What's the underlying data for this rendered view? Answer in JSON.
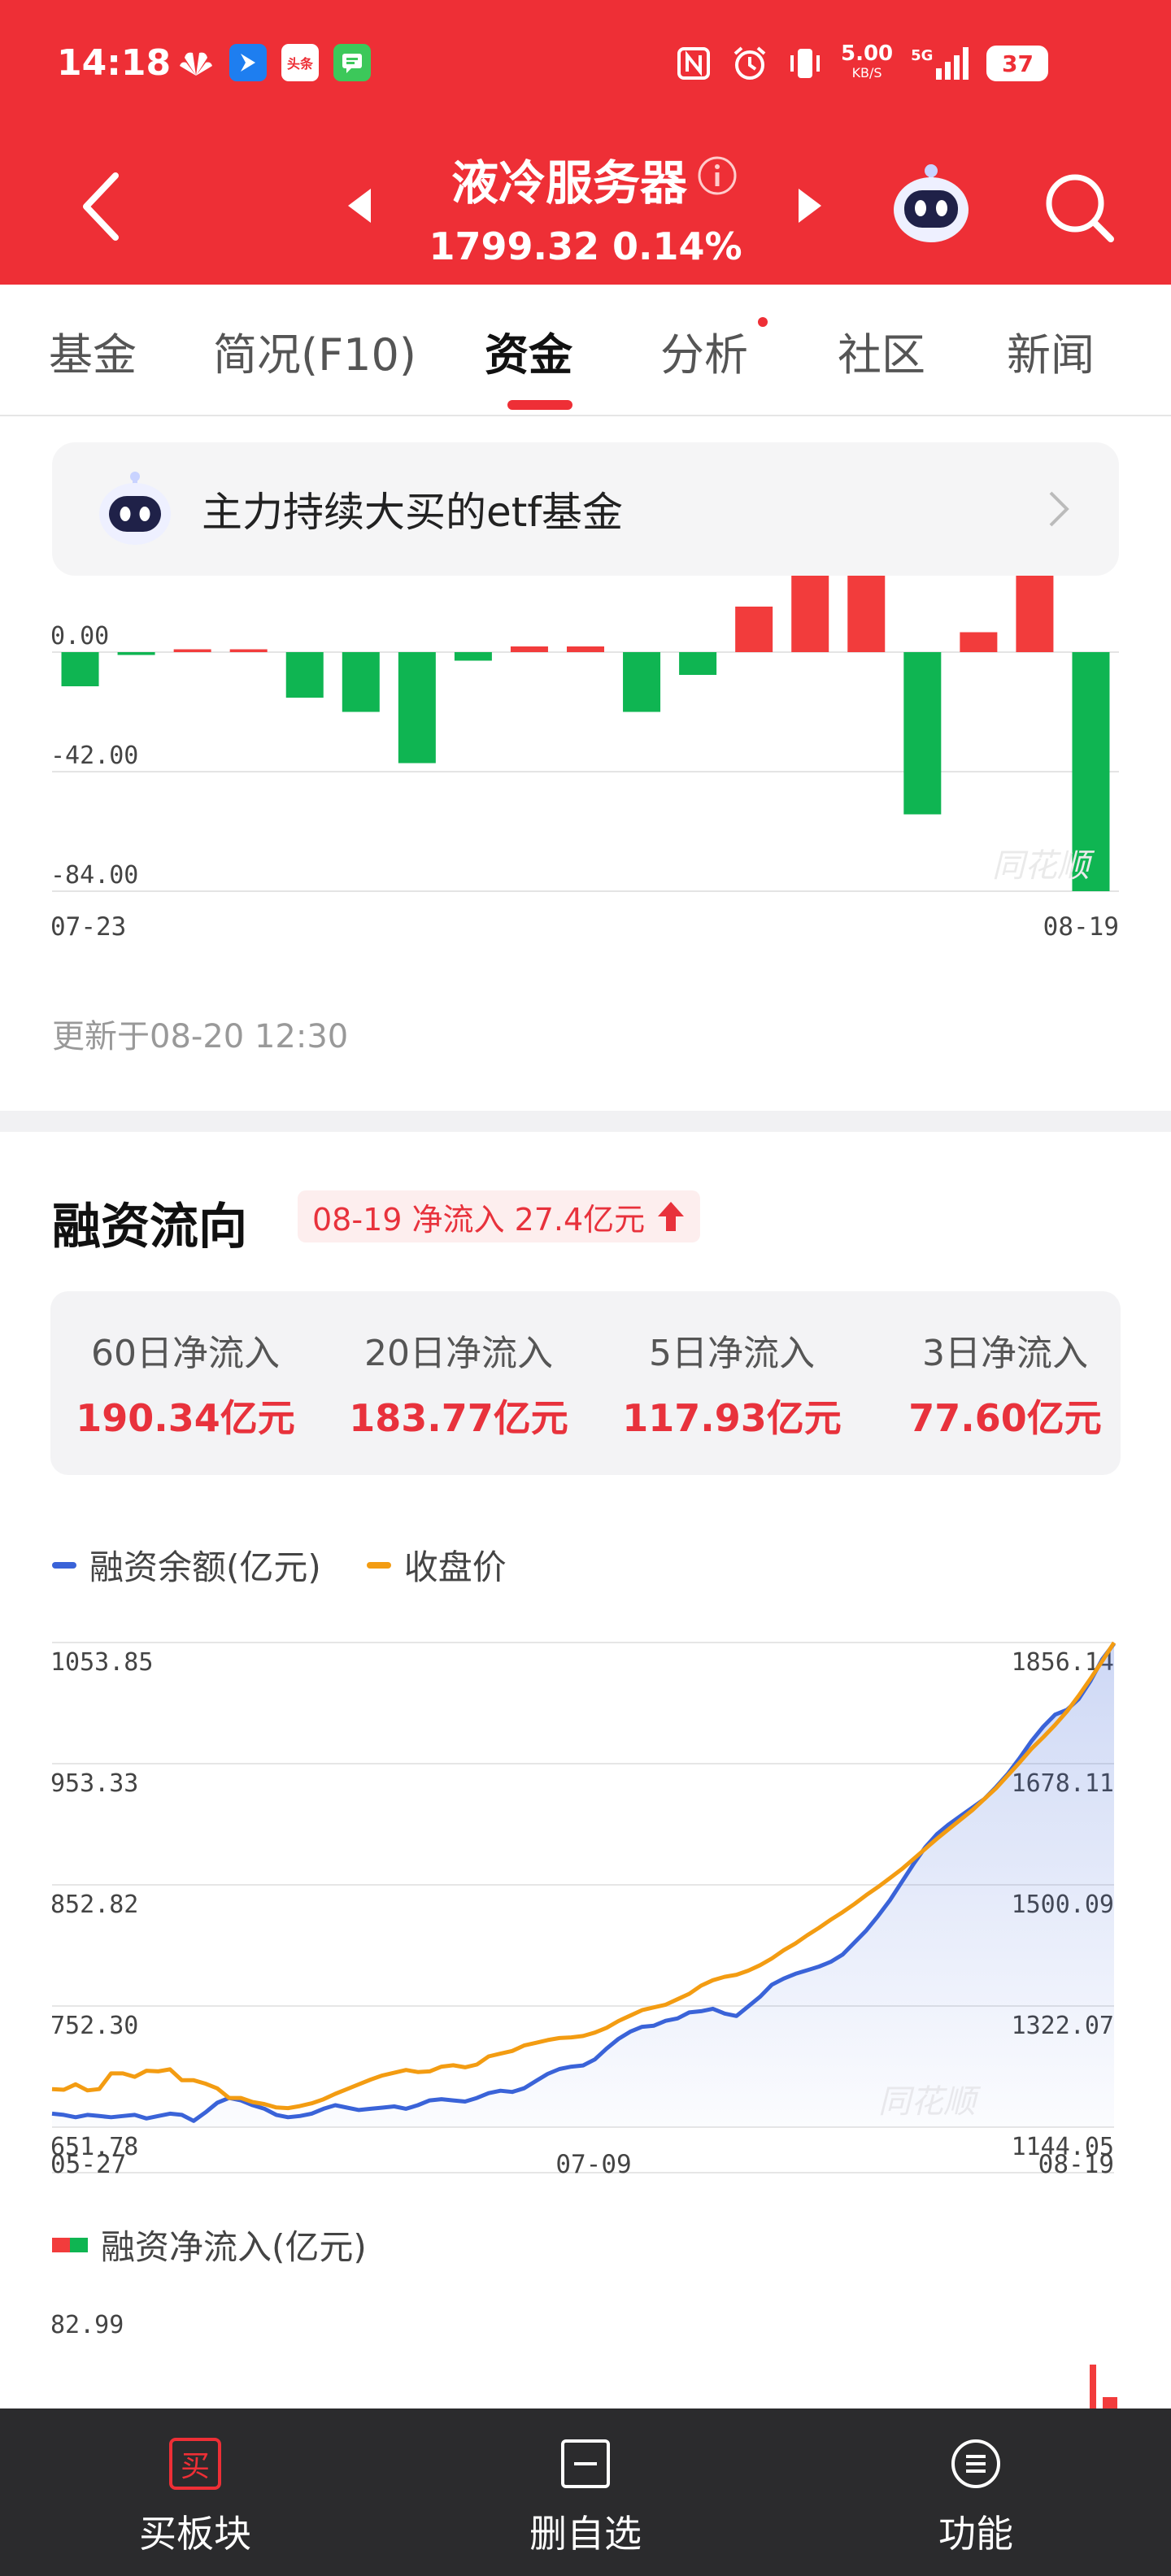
{
  "status_bar": {
    "time": "14:18",
    "app_badges": [
      "头条"
    ],
    "net_speed_value": "5.00",
    "net_speed_unit": "KB/S",
    "network": "5G",
    "battery": "37"
  },
  "header": {
    "title": "液冷服务器",
    "price_line": "1799.32 0.14%"
  },
  "tabs": [
    {
      "label": "基金"
    },
    {
      "label": "简况(F10)"
    },
    {
      "label": "资金"
    },
    {
      "label": "分析"
    },
    {
      "label": "社区"
    },
    {
      "label": "新闻"
    }
  ],
  "banner": {
    "text": "主力持续大买的etf基金"
  },
  "chart_data": [
    {
      "type": "bar",
      "title": "",
      "yticks": [
        "0.00",
        "-42.00",
        "-84.00"
      ],
      "ylim": [
        -84,
        25
      ],
      "x_start_label": "07-23",
      "x_end_label": "08-19",
      "values": [
        -12,
        -1,
        1,
        1,
        -16,
        -21,
        -39,
        -3,
        2,
        2,
        -21,
        -8,
        16,
        32,
        30,
        -57,
        7,
        33,
        -84
      ],
      "colors": {
        "positive": "#f23c3c",
        "negative": "#0fb552"
      },
      "watermark": "同花顺"
    },
    {
      "type": "line",
      "title": "",
      "series": [
        {
          "name": "融资余额(亿元)",
          "color": "#3a63d8",
          "axis": "left",
          "fill": true,
          "values": [
            663,
            662,
            660,
            662,
            661,
            660,
            661,
            662,
            659,
            661,
            663,
            662,
            657,
            664,
            672,
            676,
            674,
            670,
            667,
            662,
            660,
            661,
            663,
            667,
            670,
            668,
            666,
            667,
            668,
            669,
            667,
            670,
            674,
            675,
            674,
            673,
            676,
            680,
            682,
            681,
            684,
            690,
            696,
            700,
            702,
            703,
            708,
            717,
            725,
            731,
            735,
            736,
            740,
            742,
            747,
            748,
            750,
            746,
            744,
            752,
            760,
            770,
            775,
            779,
            782,
            785,
            789,
            795,
            805,
            815,
            827,
            840,
            855,
            870,
            884,
            895,
            903,
            910,
            917,
            924,
            934,
            945,
            958,
            972,
            984,
            994,
            998,
            1007,
            1022,
            1040,
            1053
          ]
        },
        {
          "name": "收盘价",
          "color": "#f39c12",
          "axis": "right",
          "fill": false,
          "values": [
            1200,
            1199,
            1207,
            1198,
            1200,
            1223,
            1223,
            1218,
            1227,
            1226,
            1229,
            1213,
            1213,
            1208,
            1201,
            1187,
            1187,
            1181,
            1178,
            1173,
            1172,
            1175,
            1179,
            1185,
            1193,
            1200,
            1207,
            1214,
            1220,
            1224,
            1228,
            1225,
            1226,
            1233,
            1235,
            1232,
            1236,
            1248,
            1252,
            1256,
            1264,
            1268,
            1272,
            1275,
            1276,
            1278,
            1283,
            1290,
            1300,
            1308,
            1316,
            1320,
            1324,
            1332,
            1340,
            1352,
            1360,
            1365,
            1368,
            1374,
            1382,
            1392,
            1404,
            1414,
            1426,
            1437,
            1449,
            1460,
            1472,
            1485,
            1497,
            1510,
            1523,
            1538,
            1553,
            1568,
            1582,
            1596,
            1610,
            1626,
            1642,
            1661,
            1680,
            1700,
            1717,
            1735,
            1755,
            1778,
            1803,
            1829,
            1856
          ]
        }
      ],
      "left_ticks": [
        "1053.85",
        "953.33",
        "852.82",
        "752.30",
        "651.78"
      ],
      "right_ticks": [
        "1856.14",
        "1678.11",
        "1500.09",
        "1322.07",
        "1144.05"
      ],
      "left_range": [
        651.78,
        1053.85
      ],
      "right_range": [
        1144.05,
        1856.14
      ],
      "x_labels": [
        "05-27",
        "07-09",
        "08-19"
      ],
      "legend_position": "top-left",
      "watermark": "同花顺"
    }
  ],
  "updated_text": "更新于08-20 12:30",
  "financing": {
    "section_title": "融资流向",
    "flow_tag": "08-19 净流入 27.4亿元",
    "stats": [
      {
        "label": "60日净流入",
        "value": "190.34亿元"
      },
      {
        "label": "20日净流入",
        "value": "183.77亿元"
      },
      {
        "label": "5日净流入",
        "value": "117.93亿元"
      },
      {
        "label": "3日净流入",
        "value": "77.60亿元"
      }
    ],
    "net_inflow_legend": "融资净流入(亿元)",
    "net_inflow_top_tick": "82.99"
  },
  "bottom_bar": [
    {
      "label": "买板块",
      "icon": "buy-icon",
      "icon_text": "买"
    },
    {
      "label": "删自选",
      "icon": "remove-watchlist-icon"
    },
    {
      "label": "功能",
      "icon": "menu-icon"
    }
  ]
}
